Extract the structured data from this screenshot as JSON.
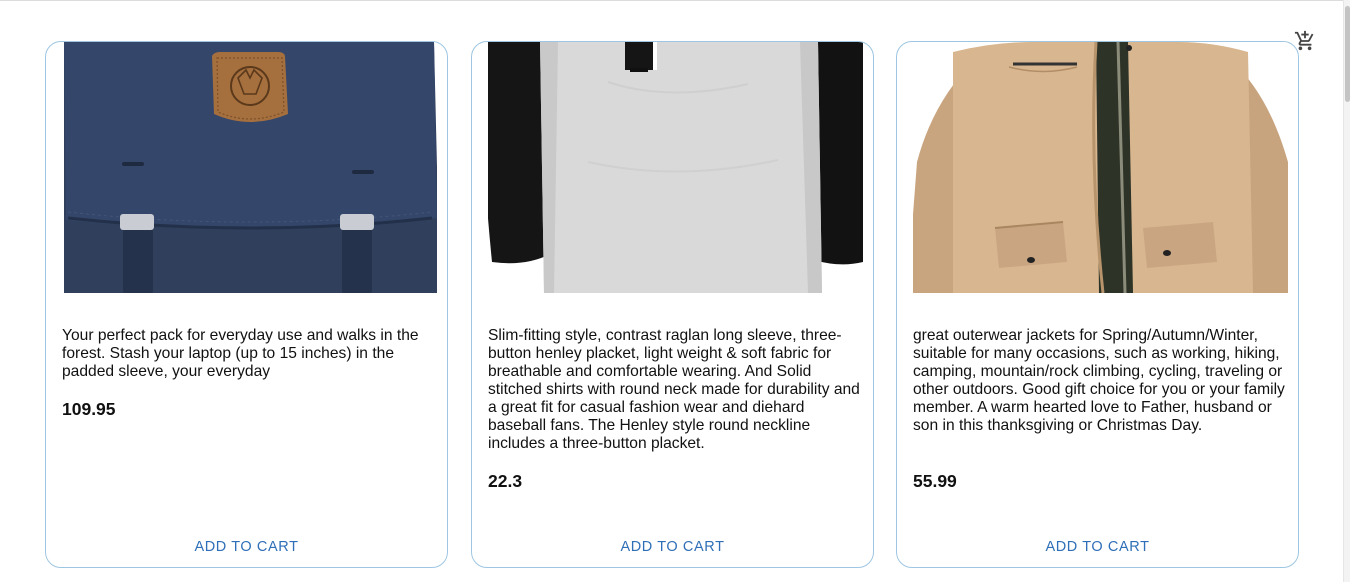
{
  "header": {
    "cart_icon": "add-shopping-cart-icon"
  },
  "products": [
    {
      "image_icon": "backpack-photo",
      "description": "Your perfect pack for everyday use and walks in the forest. Stash your laptop (up to 15 inches) in the padded sleeve, your everyday",
      "price": "109.95",
      "button_label": "ADD TO CART"
    },
    {
      "image_icon": "raglan-shirt-photo",
      "description": "Slim-fitting style, contrast raglan long sleeve, three-button henley placket, light weight & soft fabric for breathable and comfortable wearing. And Solid stitched shirts with round neck made for durability and a great fit for casual fashion wear and diehard baseball fans. The Henley style round neckline includes a three-button placket.",
      "price": "22.3",
      "button_label": "ADD TO CART"
    },
    {
      "image_icon": "jacket-photo",
      "description": "great outerwear jackets for Spring/Autumn/Winter, suitable for many occasions, such as working, hiking, camping, mountain/rock climbing, cycling, traveling or other outdoors. Good gift choice for you or your family member. A warm hearted love to Father, husband or son in this thanksgiving or Christmas Day.",
      "price": "55.99",
      "button_label": "ADD TO CART"
    }
  ],
  "colors": {
    "accent": "#2f6fb7",
    "card_border": "#9ec6e2"
  }
}
